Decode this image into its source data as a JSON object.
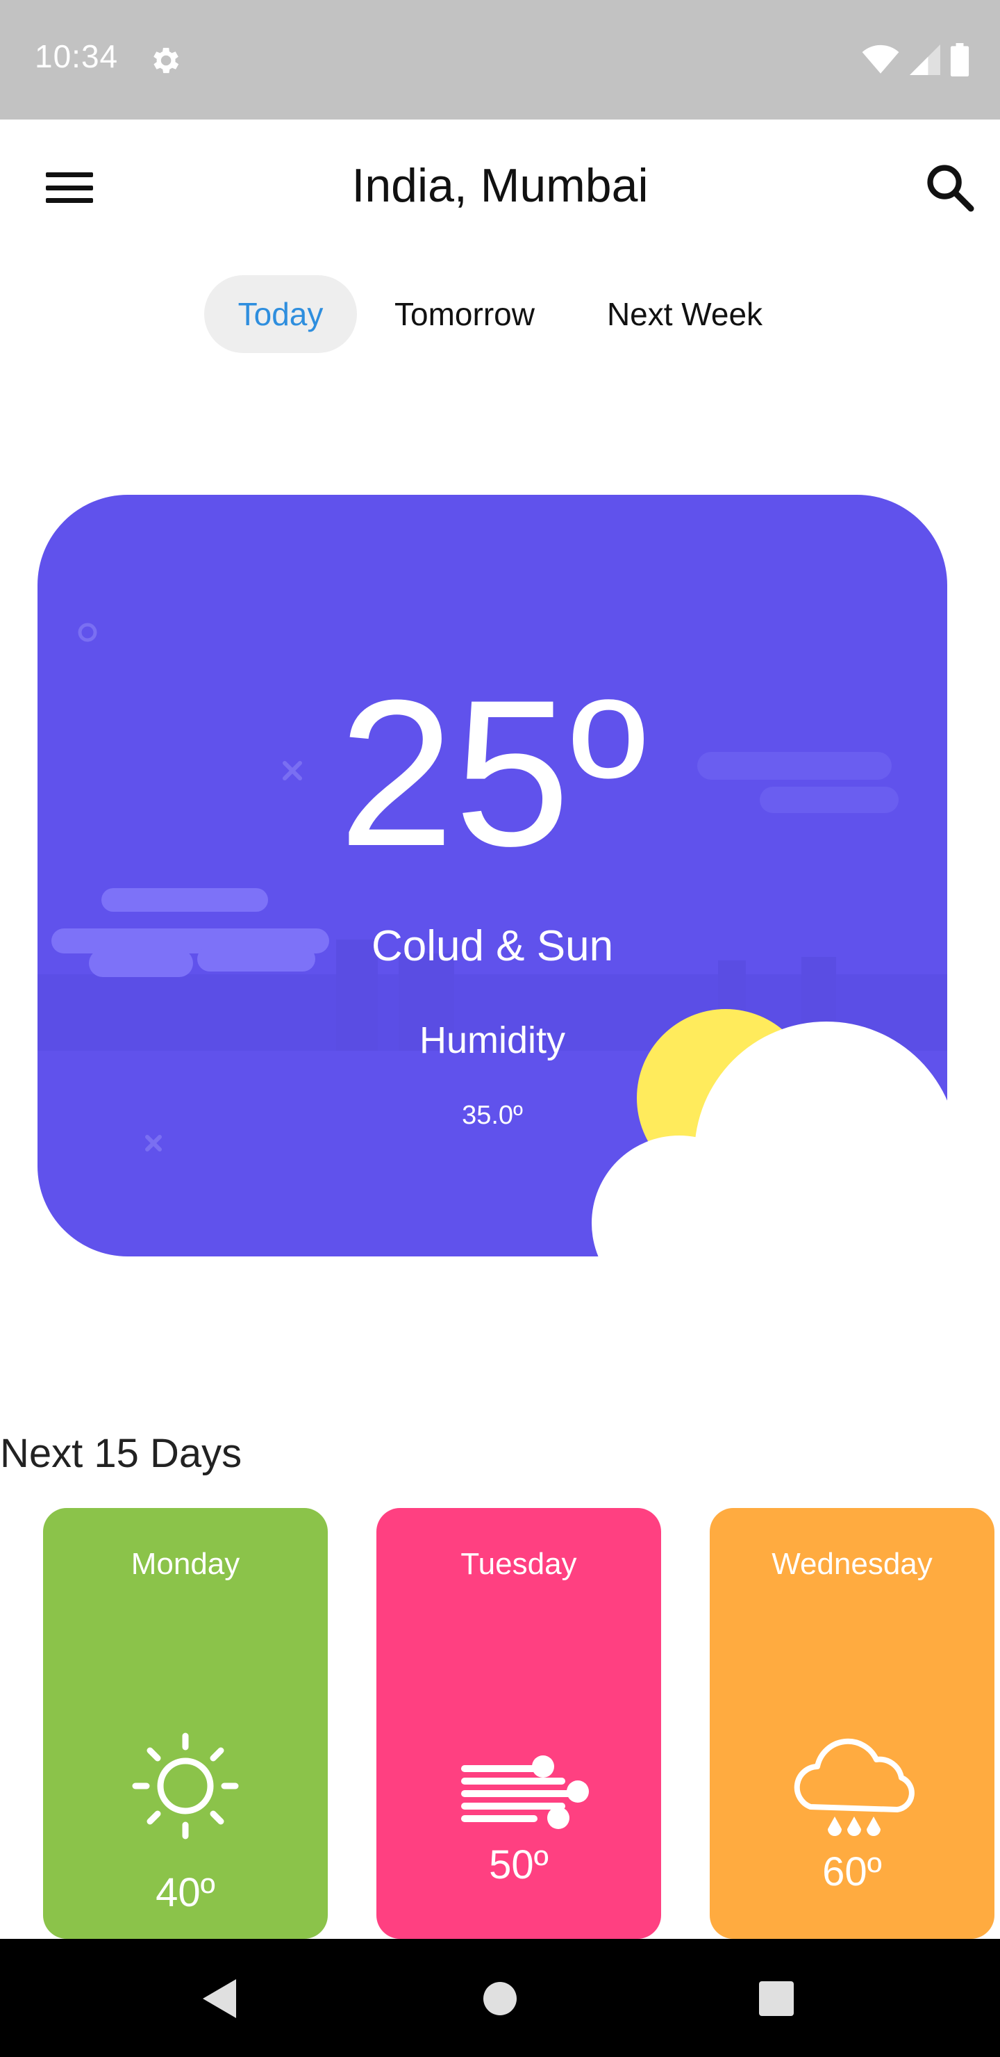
{
  "status_bar": {
    "time": "10:34",
    "icons": [
      "gear-icon",
      "wifi-icon",
      "signal-icon",
      "battery-icon"
    ]
  },
  "header": {
    "title": "India, Mumbai",
    "menu_icon": "hamburger-menu-icon",
    "search_icon": "search-icon"
  },
  "tabs": [
    {
      "label": "Today",
      "active": true
    },
    {
      "label": "Tomorrow",
      "active": false
    },
    {
      "label": "Next Week",
      "active": false
    }
  ],
  "current": {
    "temperature": "25º",
    "condition": "Colud & Sun",
    "humidity_label": "Humidity",
    "humidity_value": "35.0º",
    "icon": "sun-cloud-icon"
  },
  "forecast": {
    "title": "Next 15 Days",
    "days": [
      {
        "day": "Monday",
        "temp": "40º",
        "icon": "sun-icon",
        "color": "#8bc34a"
      },
      {
        "day": "Tuesday",
        "temp": "50º",
        "icon": "wind-icon",
        "color": "#ff4081"
      },
      {
        "day": "Wednesday",
        "temp": "60º",
        "icon": "rain-cloud-icon",
        "color": "#ffab40"
      }
    ]
  },
  "colors": {
    "card_background": "#6052ec",
    "active_tab_text": "#2e8ede",
    "sun": "#ffeb5c"
  },
  "nav_bar": {
    "icons": [
      "back-icon",
      "home-icon",
      "recents-icon"
    ]
  }
}
